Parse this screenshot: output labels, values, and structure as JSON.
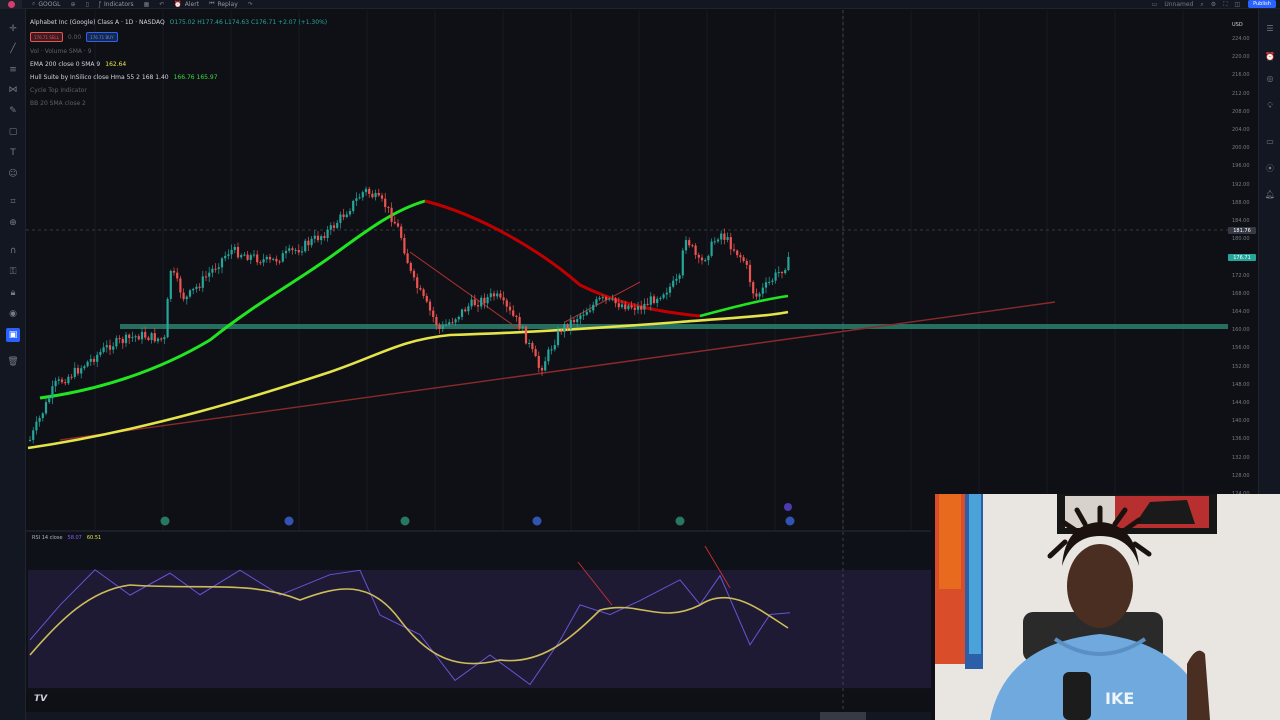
{
  "toolbar": {
    "symbol": "GOOGL",
    "indicators_label": "Indicators",
    "alert_label": "Alert",
    "replay_label": "Replay",
    "publish_label": "Publish",
    "unnamed_label": "Unnamed"
  },
  "legend": {
    "title": "Alphabet Inc (Google) Class A · 1D · NASDAQ",
    "ohlc": "O175.02 H177.46 L174.63 C176.71 +2.07 (+1.30%)",
    "sell_price": "176.71",
    "buy_price": "176.71",
    "sell_label": "SELL",
    "buy_label": "BUY",
    "vol_label": "Vol · Volume SMA · 9",
    "ema_label": "EMA 200 close 0 SMA 9",
    "ema_value": "162.64",
    "hull_label": "Hull Suite by InSilico  close Hma 55 2 168 1.40",
    "hull_values": "166.76  165.97",
    "cycle_label": "Cycle Top Indicator",
    "bb_label": "BB 20 SMA close 2"
  },
  "rsi": {
    "label": "RSI 14 close",
    "value_a": "58.07",
    "value_b": "60.51"
  },
  "price_scale": {
    "currency": "USD",
    "ticks": [
      "224.00",
      "220.00",
      "216.00",
      "212.00",
      "208.00",
      "204.00",
      "200.00",
      "196.00",
      "192.00",
      "188.00",
      "184.00",
      "180.00",
      "176.00",
      "172.00",
      "168.00",
      "164.00",
      "160.00",
      "156.00",
      "152.00",
      "148.00",
      "144.00",
      "140.00",
      "136.00",
      "132.00",
      "128.00",
      "124.00"
    ],
    "crosshair_price": "181.76",
    "last_price": "176.71"
  },
  "colors": {
    "background": "#0e1016",
    "up": "#26a69a",
    "down": "#ef5350",
    "hull_up": "#22e522",
    "hull_down": "#c00000",
    "ema": "#e4e44a",
    "rsi_line": "#7b61ff",
    "rsi_ma": "#cdbd5a",
    "support": "#2f8f7a",
    "accent": "#2962ff"
  },
  "icons": {
    "left_tools": [
      "crosshair-icon",
      "trend-line-icon",
      "fib-icon",
      "pattern-icon",
      "brush-icon",
      "text-icon",
      "measure-icon",
      "zoom-icon",
      "magnet-icon",
      "lock-icon",
      "eye-icon",
      "trash-icon"
    ],
    "right_tools": [
      "watchlist-icon",
      "alerts-icon",
      "news-icon",
      "ideas-icon",
      "chat-icon",
      "notifications-icon"
    ]
  }
}
